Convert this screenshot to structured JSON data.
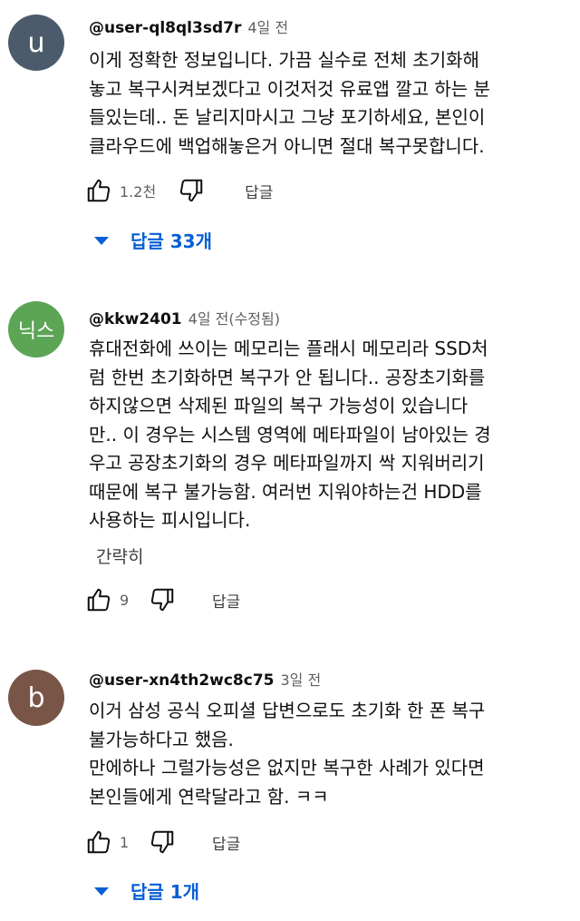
{
  "comments": [
    {
      "avatar_letter": "u",
      "avatar_color": "#4c5b6b",
      "author": "@user-ql8ql3sd7r",
      "time": "4일 전",
      "lines": [
        "이게 정확한 정보입니다. 가끔 실수로 전체 초기화해",
        "놓고 복구시켜보겠다고 이것저것 유료앱 깔고 하는 분",
        "들있는데.. 돈 날리지마시고 그냥 포기하세요, 본인이",
        "클라우드에 백업해놓은거 아니면 절대 복구못합니다."
      ],
      "like_count": "1.2천",
      "reply_label": "답글",
      "replies_toggle": "답글 33개"
    },
    {
      "avatar_letter": "닉스",
      "avatar_color": "#5ba555",
      "author": "@kkw2401",
      "time": "4일 전(수정됨)",
      "lines": [
        "휴대전화에 쓰이는 메모리는 플래시 메모리라 SSD처",
        "럼 한번 초기화하면 복구가 안 됩니다.. 공장초기화를",
        "하지않으면 삭제된 파일의 복구 가능성이 있습니다",
        "만.. 이 경우는 시스템 영역에 메타파일이 남아있는 경",
        "우고 공장초기화의 경우 메타파일까지 싹 지워버리기",
        "때문에 복구 불가능함. 여러번 지워야하는건 HDD를",
        "사용하는 피시입니다."
      ],
      "collapse_label": "간략히",
      "like_count": "9",
      "reply_label": "답글"
    },
    {
      "avatar_letter": "b",
      "avatar_color": "#795548",
      "author": "@user-xn4th2wc8c75",
      "time": "3일 전",
      "lines": [
        "이거 삼성 공식 오피셜 답변으로도 초기화 한 폰 복구",
        "불가능하다고 했음.",
        "만에하나 그럴가능성은 없지만 복구한 사례가 있다면",
        "본인들에게 연락달라고 함. ㅋㅋ"
      ],
      "like_count": "1",
      "reply_label": "답글",
      "replies_toggle": "답글 1개"
    }
  ]
}
